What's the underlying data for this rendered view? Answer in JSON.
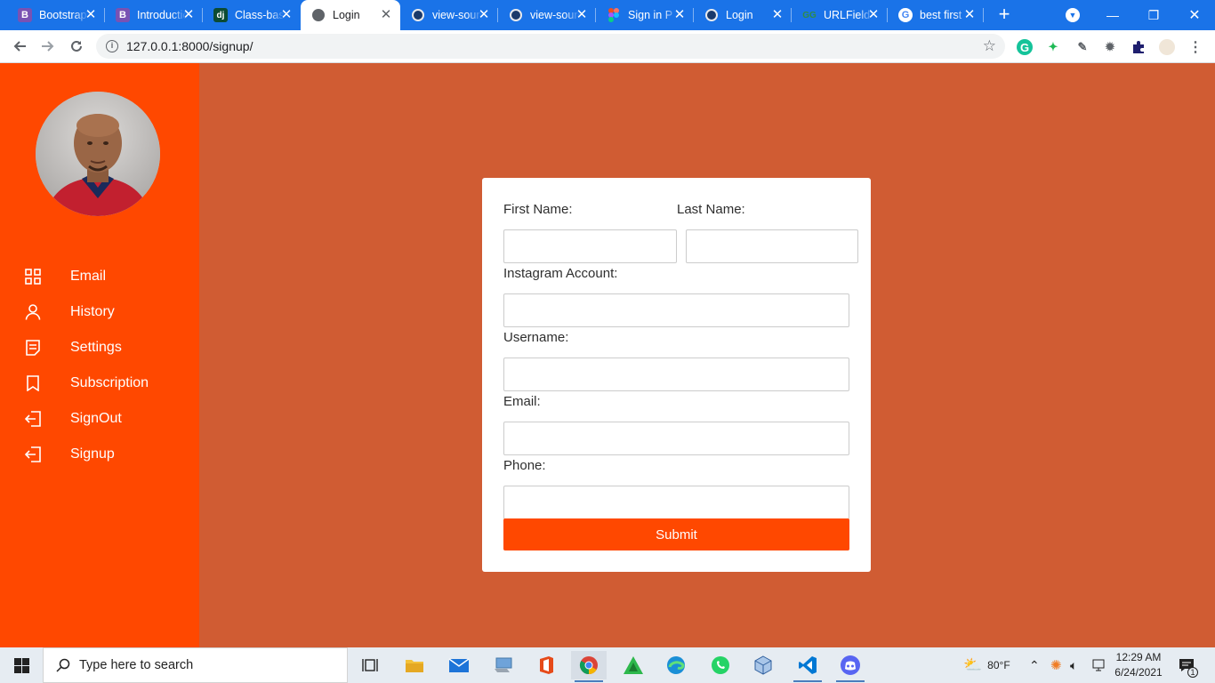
{
  "browser": {
    "tabs": [
      {
        "title": "Bootstrap",
        "favicon": "bootstrap-icon",
        "active": false
      },
      {
        "title": "Introduction",
        "favicon": "bootstrap-icon",
        "active": false
      },
      {
        "title": "Class-based",
        "favicon": "django-icon",
        "active": false
      },
      {
        "title": "Login",
        "favicon": "globe-icon",
        "active": true
      },
      {
        "title": "view-source",
        "favicon": "globe-icon",
        "active": false
      },
      {
        "title": "view-source",
        "favicon": "globe-icon",
        "active": false
      },
      {
        "title": "Sign in P",
        "favicon": "figma-icon",
        "active": false
      },
      {
        "title": "Login",
        "favicon": "globe-icon",
        "active": false
      },
      {
        "title": "URLField",
        "favicon": "geeks-icon",
        "active": false
      },
      {
        "title": "best first",
        "favicon": "google-icon",
        "active": false
      }
    ],
    "url": "127.0.0.1:8000/signup/",
    "accent": "#1a73e8"
  },
  "sidebar": {
    "color": "#ff4800",
    "items": [
      {
        "label": "Email",
        "icon": "grid-icon"
      },
      {
        "label": "History",
        "icon": "user-icon"
      },
      {
        "label": "Settings",
        "icon": "document-icon"
      },
      {
        "label": "Subscription",
        "icon": "bookmark-icon"
      },
      {
        "label": "SignOut",
        "icon": "signout-icon"
      },
      {
        "label": "Signup",
        "icon": "signup-icon"
      }
    ]
  },
  "form": {
    "first_name_label": "First Name:",
    "last_name_label": "Last Name:",
    "instagram_label": "Instagram Account:",
    "username_label": "Username:",
    "email_label": "Email:",
    "phone_label": "Phone:",
    "first_name_value": "",
    "last_name_value": "",
    "instagram_value": "",
    "username_value": "",
    "email_value": "",
    "phone_value": "",
    "submit_label": "Submit",
    "background": "#d05c33"
  },
  "taskbar": {
    "search_placeholder": "Type here to search",
    "weather": "80°F",
    "time": "12:29 AM",
    "date": "6/24/2021",
    "notification_count": "1"
  }
}
